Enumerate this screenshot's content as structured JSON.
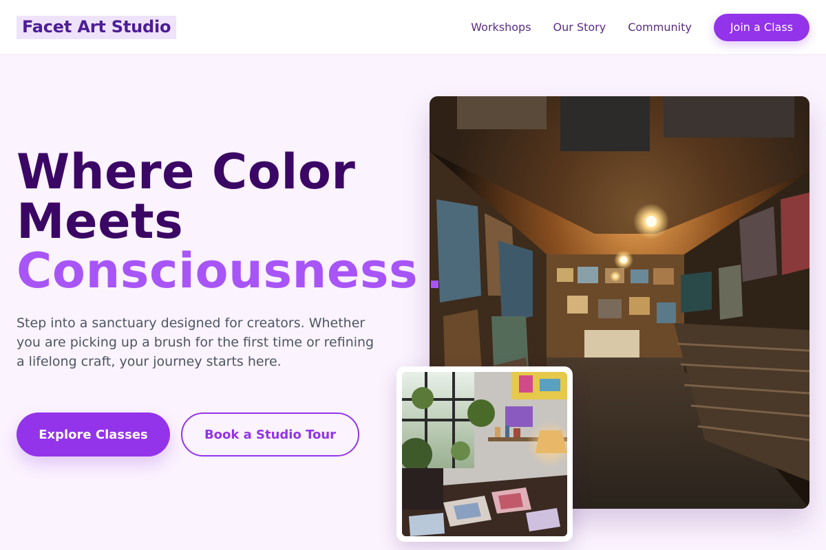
{
  "brand": {
    "name": "Facet Art Studio"
  },
  "nav": {
    "links": [
      "Workshops",
      "Our Story",
      "Community"
    ],
    "cta_label": "Join a Class"
  },
  "hero": {
    "headline_line1": "Where Color",
    "headline_line2": "Meets",
    "headline_line3": "Consciousness",
    "description": "Step into a sanctuary designed for creators. Whether you are picking up a brush for the first time or refining a lifelong craft, your journey starts here.",
    "primary_button": "Explore Classes",
    "secondary_button": "Book a Studio Tour"
  },
  "colors": {
    "brand_purple": "#9333ea",
    "headline_dark": "#3b0764",
    "headline_accent": "#a855f7",
    "page_background": "#fbf3fe"
  },
  "images": {
    "main": "art-gallery-photo",
    "inset": "studio-workspace-photo"
  }
}
